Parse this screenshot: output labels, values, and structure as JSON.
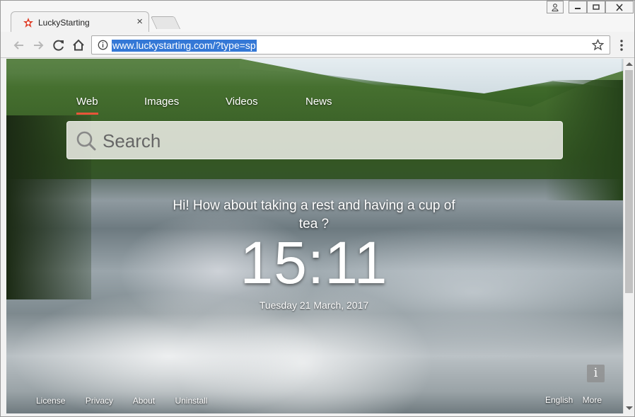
{
  "browser": {
    "tab_title": "LuckyStarting",
    "tab_close": "×",
    "url": "www.luckystarting.com/?type=sp",
    "icons": {
      "back": "back-arrow-icon",
      "forward": "forward-arrow-icon",
      "reload": "reload-icon",
      "home": "home-icon",
      "info": "info-circle-icon",
      "bookmark": "star-icon",
      "menu": "kebab-menu-icon",
      "favicon": "lucky-starting-logo-icon"
    },
    "colors": {
      "url_highlight": "#3478d6",
      "favicon": "#e0412b"
    }
  },
  "page": {
    "tabs": [
      {
        "label": "Web",
        "active": true
      },
      {
        "label": "Images",
        "active": false
      },
      {
        "label": "Videos",
        "active": false
      },
      {
        "label": "News",
        "active": false
      }
    ],
    "search": {
      "placeholder": "Search",
      "value": ""
    },
    "greeting": "Hi! How about taking a rest and having a cup of tea ?",
    "clock": "15:11",
    "date": "Tuesday 21 March, 2017",
    "footer_left": [
      "License",
      "Privacy",
      "About",
      "Uninstall"
    ],
    "footer_right": [
      "English",
      "More"
    ],
    "info_button": "i",
    "colors": {
      "active_tab_underline": "#e8553a"
    }
  }
}
